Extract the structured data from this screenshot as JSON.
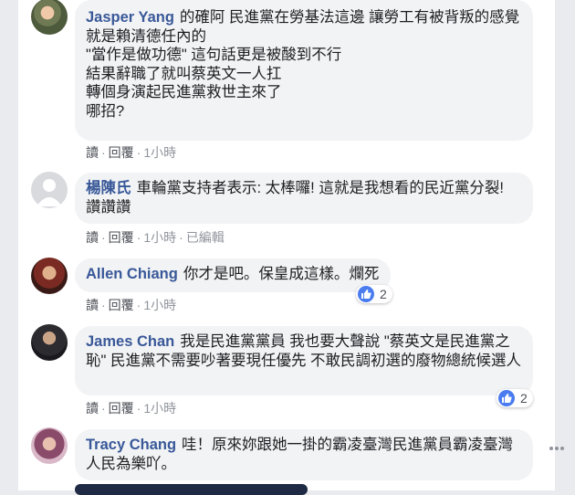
{
  "actions": {
    "reply": "讀",
    "sep": "·",
    "reply2": "回覆"
  },
  "comments": [
    {
      "author": "Jasper Yang",
      "text": "的確阿 民進黨在勞基法這邊 讓勞工有被背叛的感覺\n就是賴清德任內的\n\"當作是做功德\" 這句話更是被酸到不行\n結果辭職了就叫蔡英文一人扛\n轉個身演起民進黨救世主來了\n哪招?",
      "time": "1小時",
      "edited": ""
    },
    {
      "author": "楊陳氏",
      "text": "車輪黨支持者表示: 太棒囉! 這就是我想看的民近黨分裂! 讚讚讚",
      "time": "1小時",
      "edited": "已編輯"
    },
    {
      "author": "Allen Chiang",
      "text": "你才是吧。保皇成這樣。爛死",
      "time": "1小時",
      "likes": "2"
    },
    {
      "author": "James Chan",
      "text": "我是民進黨黨員 我也要大聲說 \"蔡英文是民進黨之恥\" 民進黨不需要吵著要現任優先 不敢民調初選的廢物總統候選人",
      "time": "1小時",
      "likes": "2"
    },
    {
      "author": "Tracy Chang",
      "text": "哇！原來妳跟她一掛的霸凌臺灣民進黨員霸凌臺灣人民為樂吖。"
    }
  ],
  "colors": {
    "author": "#385898",
    "bubble": "#f2f3f5",
    "like": "#4a7cf0"
  }
}
